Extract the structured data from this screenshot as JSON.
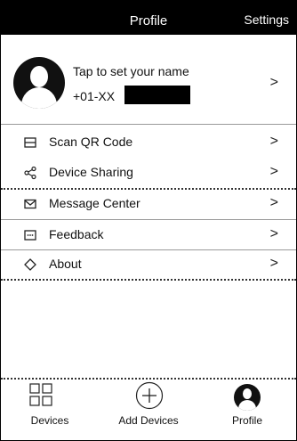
{
  "header": {
    "title": "Profile",
    "settings_label": "Settings"
  },
  "profile": {
    "name_prompt": "Tap to set your name",
    "phone": "+01-XX"
  },
  "menu": [
    {
      "label": "Scan QR Code",
      "icon": "qr-code-icon"
    },
    {
      "label": "Device Sharing",
      "icon": "share-icon"
    },
    {
      "label": "Message Center",
      "icon": "mail-icon"
    },
    {
      "label": "Feedback",
      "icon": "feedback-icon"
    },
    {
      "label": "About",
      "icon": "diamond-icon"
    }
  ],
  "tabs": [
    {
      "label": "Devices",
      "icon": "grid-icon"
    },
    {
      "label": "Add Devices",
      "icon": "plus-circle-icon"
    },
    {
      "label": "Profile",
      "icon": "avatar-icon"
    }
  ],
  "chevron": ">"
}
